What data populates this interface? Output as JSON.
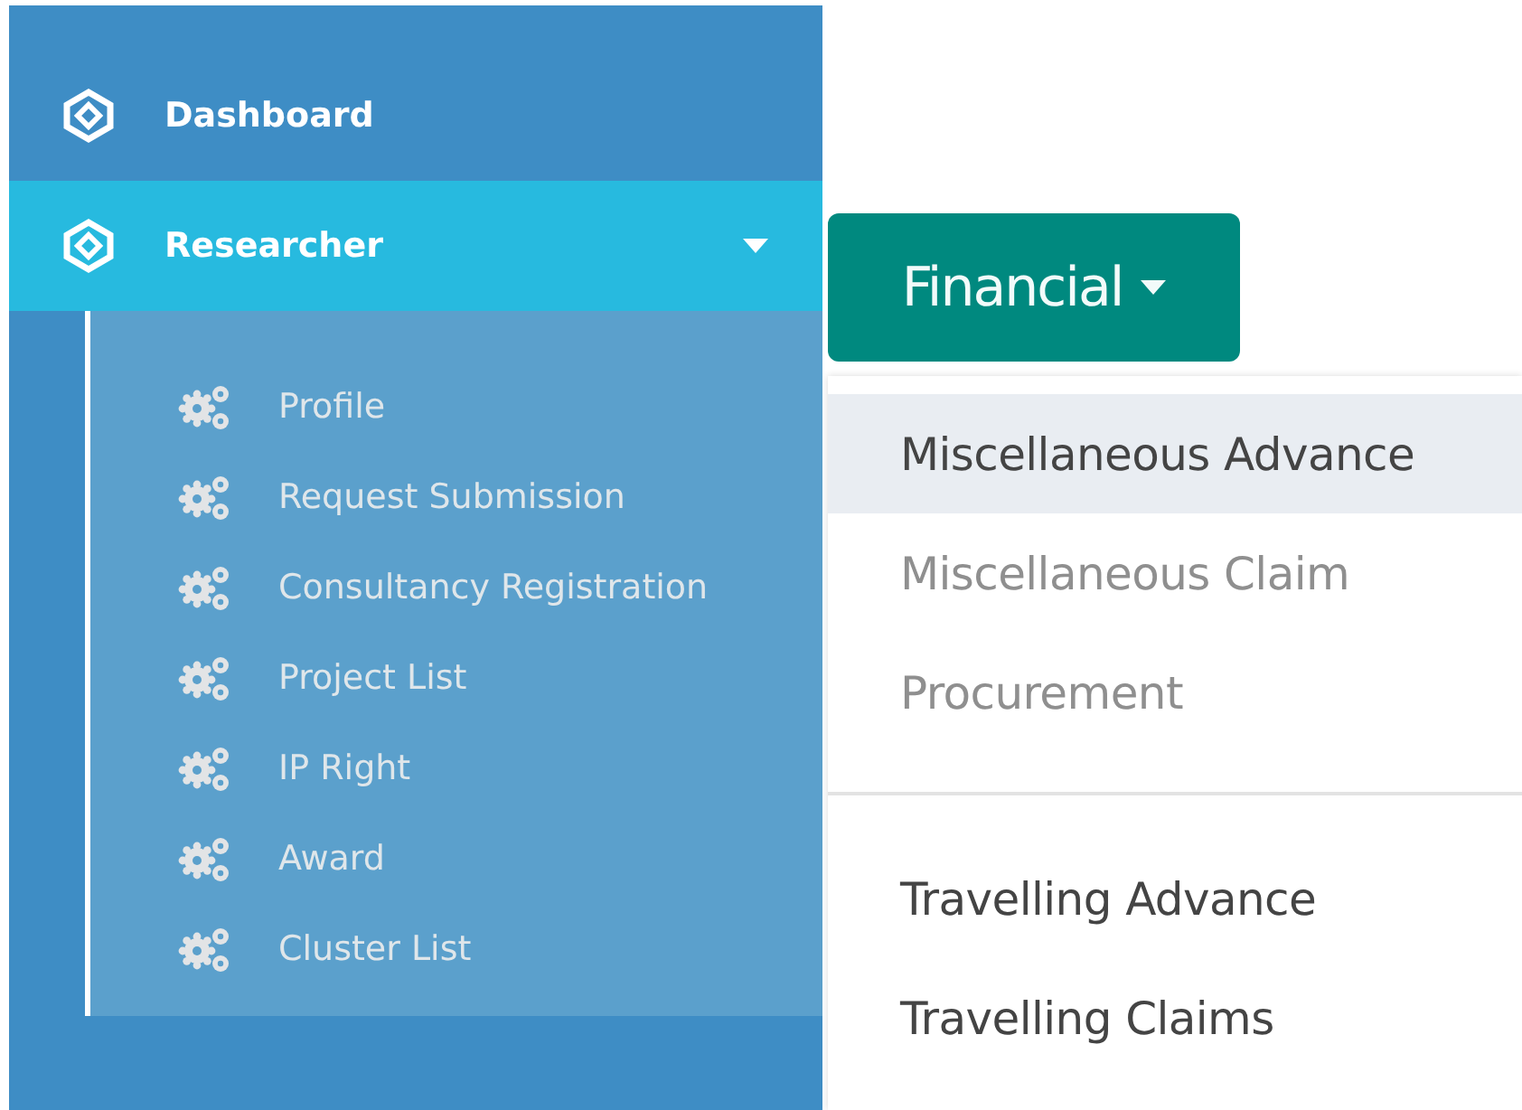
{
  "sidebar": {
    "items": [
      {
        "label": "Dashboard",
        "selected": false
      },
      {
        "label": "Researcher",
        "selected": true,
        "expanded": true,
        "children": [
          {
            "label": "Profile"
          },
          {
            "label": "Request Submission"
          },
          {
            "label": "Consultancy Registration"
          },
          {
            "label": "Project List"
          },
          {
            "label": "IP Right"
          },
          {
            "label": "Award"
          },
          {
            "label": "Cluster List"
          }
        ]
      }
    ]
  },
  "financial_menu": {
    "button": "Financial",
    "groups": [
      [
        {
          "label": "Miscellaneous Advance",
          "selected": true,
          "disabled": false
        },
        {
          "label": "Miscellaneous Claim",
          "selected": false,
          "disabled": true
        },
        {
          "label": "Procurement",
          "selected": false,
          "disabled": true
        }
      ],
      [
        {
          "label": "Travelling Advance",
          "selected": false,
          "disabled": false
        },
        {
          "label": "Travelling Claims",
          "selected": false,
          "disabled": false
        }
      ]
    ]
  }
}
